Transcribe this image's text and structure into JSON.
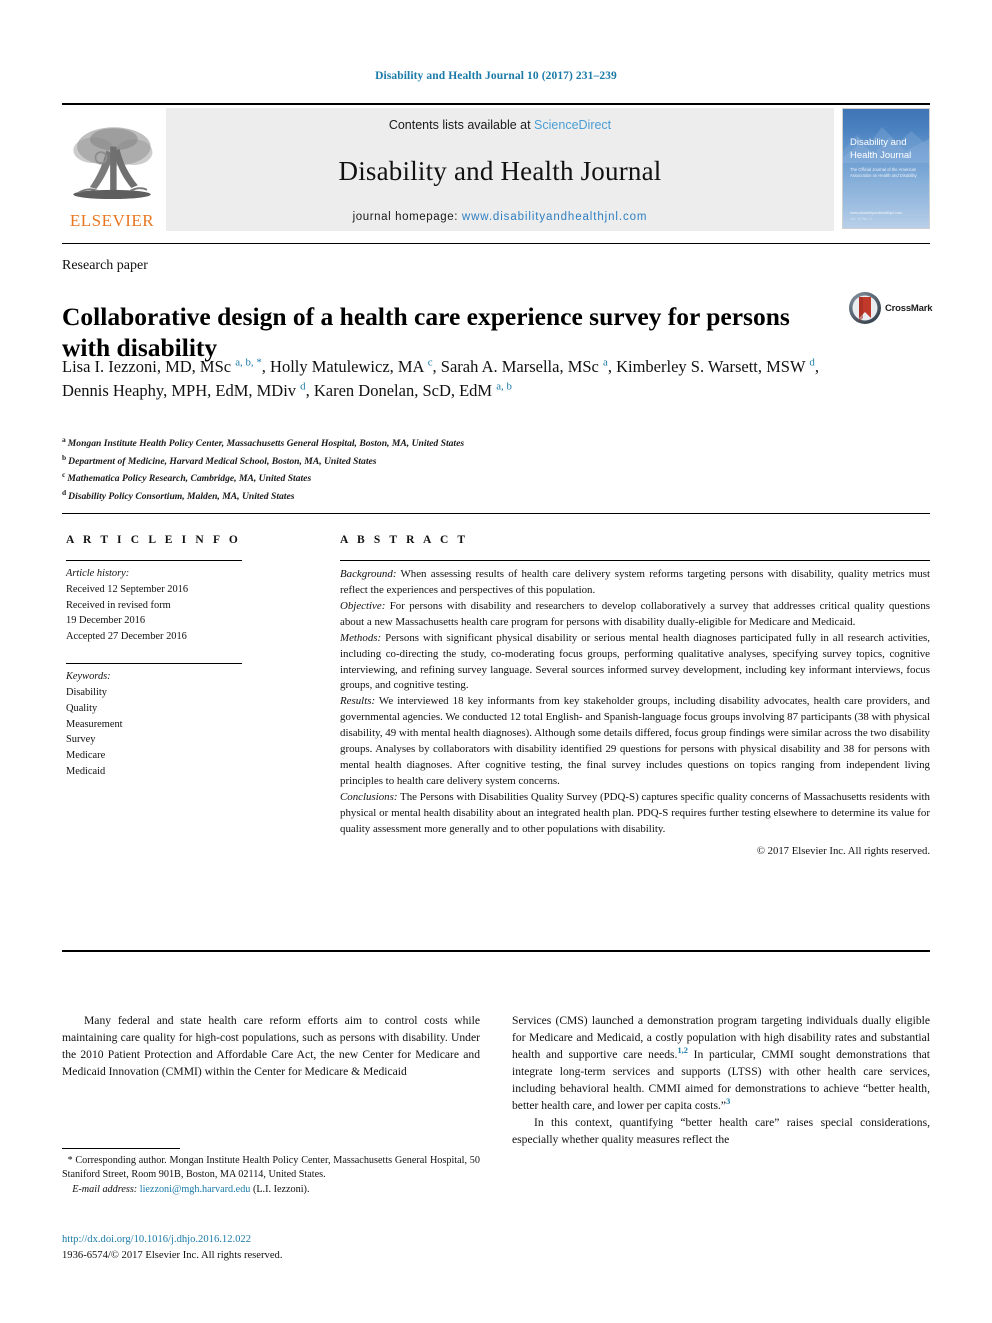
{
  "running_head": "Disability and Health Journal 10 (2017) 231–239",
  "masthead": {
    "publisher_logo_text": "ELSEVIER",
    "contents_prefix": "Contents lists available at ",
    "contents_link": "ScienceDirect",
    "journal_name": "Disability and Health Journal",
    "homepage_prefix": "journal homepage: ",
    "homepage_url": "www.disabilityandhealthjnl.com",
    "cover": {
      "title_line1": "Disability and",
      "title_line2": "Health Journal",
      "subtitle": "The Official Journal of the American Association on Health and Disability",
      "footer_line1": "www.disabilityandhealthjnl.com",
      "footer_line2": "Vol. 10  No. 2"
    }
  },
  "article": {
    "doc_type": "Research paper",
    "title": "Collaborative design of a health care experience survey for persons with disability",
    "crossmark_label": "CrossMark",
    "authors_html": "Lisa I. Iezzoni, MD, MSc <sup>a, b, *</sup>, Holly Matulewicz, MA <sup>c</sup>, Sarah A. Marsella, MSc <sup>a</sup>, Kimberley S. Warsett, MSW <sup>d</sup>, Dennis Heaphy, MPH, EdM, MDiv <sup>d</sup>, Karen Donelan, ScD, EdM <sup>a, b</sup>",
    "affiliations": [
      {
        "label": "a",
        "text": "Mongan Institute Health Policy Center, Massachusetts General Hospital, Boston, MA, United States"
      },
      {
        "label": "b",
        "text": "Department of Medicine, Harvard Medical School, Boston, MA, United States"
      },
      {
        "label": "c",
        "text": "Mathematica Policy Research, Cambridge, MA, United States"
      },
      {
        "label": "d",
        "text": "Disability Policy Consortium, Malden, MA, United States"
      }
    ]
  },
  "article_info": {
    "heading": "A R T I C L E  I N F O",
    "history_label": "Article history:",
    "history_lines": [
      "Received 12 September 2016",
      "Received in revised form",
      "19 December 2016",
      "Accepted 27 December 2016"
    ],
    "keywords_label": "Keywords:",
    "keywords": [
      "Disability",
      "Quality",
      "Measurement",
      "Survey",
      "Medicare",
      "Medicaid"
    ]
  },
  "abstract": {
    "heading": "A B S T R A C T",
    "sections": [
      {
        "label": "Background:",
        "text": " When assessing results of health care delivery system reforms targeting persons with disability, quality metrics must reflect the experiences and perspectives of this population."
      },
      {
        "label": "Objective:",
        "text": " For persons with disability and researchers to develop collaboratively a survey that addresses critical quality questions about a new Massachusetts health care program for persons with disability dually-eligible for Medicare and Medicaid."
      },
      {
        "label": "Methods:",
        "text": " Persons with significant physical disability or serious mental health diagnoses participated fully in all research activities, including co-directing the study, co-moderating focus groups, performing qualitative analyses, specifying survey topics, cognitive interviewing, and refining survey language. Several sources informed survey development, including key informant interviews, focus groups, and cognitive testing."
      },
      {
        "label": "Results:",
        "text": " We interviewed 18 key informants from key stakeholder groups, including disability advocates, health care providers, and governmental agencies. We conducted 12 total English- and Spanish-language focus groups involving 87 participants (38 with physical disability, 49 with mental health diagnoses). Although some details differed, focus group findings were similar across the two disability groups. Analyses by collaborators with disability identified 29 questions for persons with physical disability and 38 for persons with mental health diagnoses. After cognitive testing, the final survey includes questions on topics ranging from independent living principles to health care delivery system concerns."
      },
      {
        "label": "Conclusions:",
        "text": " The Persons with Disabilities Quality Survey (PDQ-S) captures specific quality concerns of Massachusetts residents with physical or mental health disability about an integrated health plan. PDQ-S requires further testing elsewhere to determine its value for quality assessment more generally and to other populations with disability."
      }
    ],
    "copyright": "© 2017 Elsevier Inc. All rights reserved."
  },
  "body": {
    "left_paragraph": "Many federal and state health care reform efforts aim to control costs while maintaining care quality for high-cost populations, such as persons with disability. Under the 2010 Patient Protection and Affordable Care Act, the new Center for Medicare and Medicaid Innovation (CMMI) within the Center for Medicare & Medicaid",
    "right_paragraph_1_a": "Services (CMS) launched a demonstration program targeting individuals dually eligible for Medicare and Medicaid, a costly population with high disability rates and substantial health and supportive care needs.",
    "right_ref_1": "1,2",
    "right_paragraph_1_b": " In particular, CMMI sought demonstrations that integrate long-term services and supports (LTSS) with other health care services, including behavioral health. CMMI aimed for demonstrations to achieve “better health, better health care, and lower per capita costs.”",
    "right_ref_2": "3",
    "right_paragraph_2": "In this context, quantifying “better health care” raises special considerations, especially whether quality measures reflect the"
  },
  "footnote": {
    "star": "*",
    "corresponding_text": " Corresponding author. Mongan Institute Health Policy Center, Massachusetts General Hospital, 50 Staniford Street, Room 901B, Boston, MA 02114, United States.",
    "email_label": "E-mail address:",
    "email": "liezzoni@mgh.harvard.edu",
    "email_suffix": " (L.I. Iezzoni)."
  },
  "footer": {
    "doi": "http://dx.doi.org/10.1016/j.dhjo.2016.12.022",
    "issn_line": "1936-6574/© 2017 Elsevier Inc. All rights reserved."
  },
  "colors": {
    "link_blue": "#1a7aa8",
    "sciencedirect_blue": "#4a9ed4",
    "homepage_blue": "#2f7fc1",
    "elsevier_orange": "#e87722",
    "band_grey": "#ededed",
    "cover_blue": "#4b82c0"
  }
}
